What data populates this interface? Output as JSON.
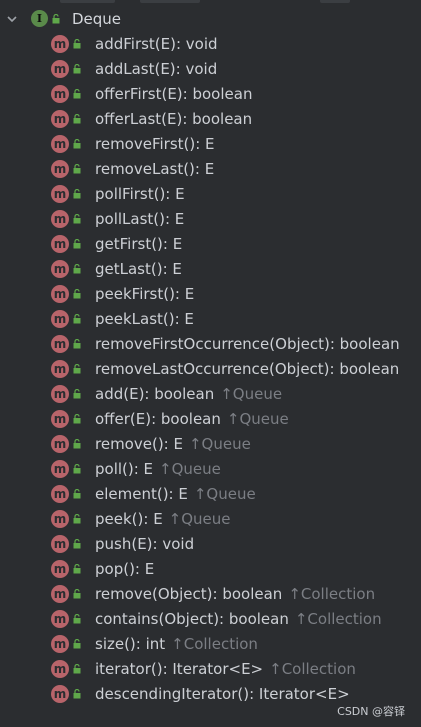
{
  "root": {
    "label": "Deque",
    "icon": "interface-icon"
  },
  "methods": [
    {
      "name": "addFirst(E): void",
      "origin": ""
    },
    {
      "name": "addLast(E): void",
      "origin": ""
    },
    {
      "name": "offerFirst(E): boolean",
      "origin": ""
    },
    {
      "name": "offerLast(E): boolean",
      "origin": ""
    },
    {
      "name": "removeFirst(): E",
      "origin": ""
    },
    {
      "name": "removeLast(): E",
      "origin": ""
    },
    {
      "name": "pollFirst(): E",
      "origin": ""
    },
    {
      "name": "pollLast(): E",
      "origin": ""
    },
    {
      "name": "getFirst(): E",
      "origin": ""
    },
    {
      "name": "getLast(): E",
      "origin": ""
    },
    {
      "name": "peekFirst(): E",
      "origin": ""
    },
    {
      "name": "peekLast(): E",
      "origin": ""
    },
    {
      "name": "removeFirstOccurrence(Object): boolean",
      "origin": ""
    },
    {
      "name": "removeLastOccurrence(Object): boolean",
      "origin": ""
    },
    {
      "name": "add(E): boolean",
      "origin": "↑Queue"
    },
    {
      "name": "offer(E): boolean",
      "origin": "↑Queue"
    },
    {
      "name": "remove(): E",
      "origin": "↑Queue"
    },
    {
      "name": "poll(): E",
      "origin": "↑Queue"
    },
    {
      "name": "element(): E",
      "origin": "↑Queue"
    },
    {
      "name": "peek(): E",
      "origin": "↑Queue"
    },
    {
      "name": "push(E): void",
      "origin": ""
    },
    {
      "name": "pop(): E",
      "origin": ""
    },
    {
      "name": "remove(Object): boolean",
      "origin": "↑Collection"
    },
    {
      "name": "contains(Object): boolean",
      "origin": "↑Collection"
    },
    {
      "name": "size(): int",
      "origin": "↑Collection"
    },
    {
      "name": "iterator(): Iterator<E>",
      "origin": "↑Collection"
    },
    {
      "name": "descendingIterator(): Iterator<E>",
      "origin": ""
    }
  ],
  "icons": {
    "method": "method-icon",
    "visibility": "public-lock-icon"
  },
  "colors": {
    "background": "#2b2d30",
    "method_badge": "#b8646a",
    "interface_badge": "#5a8a4a",
    "lock": "#5fa84a",
    "origin": "#7b7e84"
  },
  "watermark": "CSDN @容铎"
}
